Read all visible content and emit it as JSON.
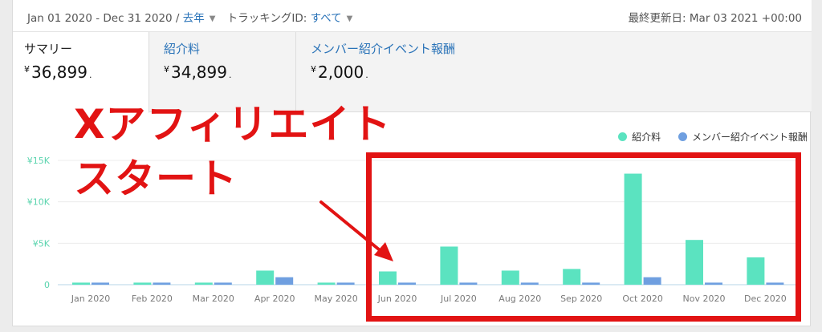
{
  "topbar": {
    "date_range": "Jan 01 2020 - Dec 31 2020 /",
    "period": "去年",
    "tracking_label": "トラッキングID:",
    "tracking_value": "すべて",
    "last_updated": "最終更新日: Mar 03 2021 +00:00",
    "chevron_icon": "chevron-down-icon"
  },
  "tabs": [
    {
      "label": "サマリー",
      "currency": "¥",
      "value": "36,899",
      "suffix": "."
    },
    {
      "label": "紹介料",
      "currency": "¥",
      "value": "34,899",
      "suffix": "."
    },
    {
      "label": "メンバー紹介イベント報酬",
      "currency": "¥",
      "value": "2,000",
      "suffix": "."
    }
  ],
  "colors": {
    "referral": "#5be3c0",
    "member": "#6f9fe0",
    "accent_link": "#2a73b8",
    "annotation": "#e21313"
  },
  "chart_data": {
    "type": "bar",
    "categories": [
      "Jan 2020",
      "Feb 2020",
      "Mar 2020",
      "Apr 2020",
      "May 2020",
      "Jun 2020",
      "Jul 2020",
      "Aug 2020",
      "Sep 2020",
      "Oct 2020",
      "Nov 2020",
      "Dec 2020"
    ],
    "series": [
      {
        "name": "紹介料",
        "values": [
          250,
          250,
          250,
          1700,
          250,
          1600,
          4600,
          1700,
          1900,
          13400,
          5400,
          3300
        ]
      },
      {
        "name": "メンバー紹介イベント報酬",
        "values": [
          250,
          250,
          250,
          900,
          250,
          250,
          250,
          250,
          250,
          900,
          250,
          250
        ]
      }
    ],
    "yticks": [
      "0",
      "¥5K",
      "¥10K",
      "¥15K"
    ],
    "ylim": [
      0,
      15000
    ],
    "grid": true,
    "legend": "top-right"
  },
  "annotation": {
    "line1": "Xアフィリエイト",
    "line2": "スタート"
  }
}
